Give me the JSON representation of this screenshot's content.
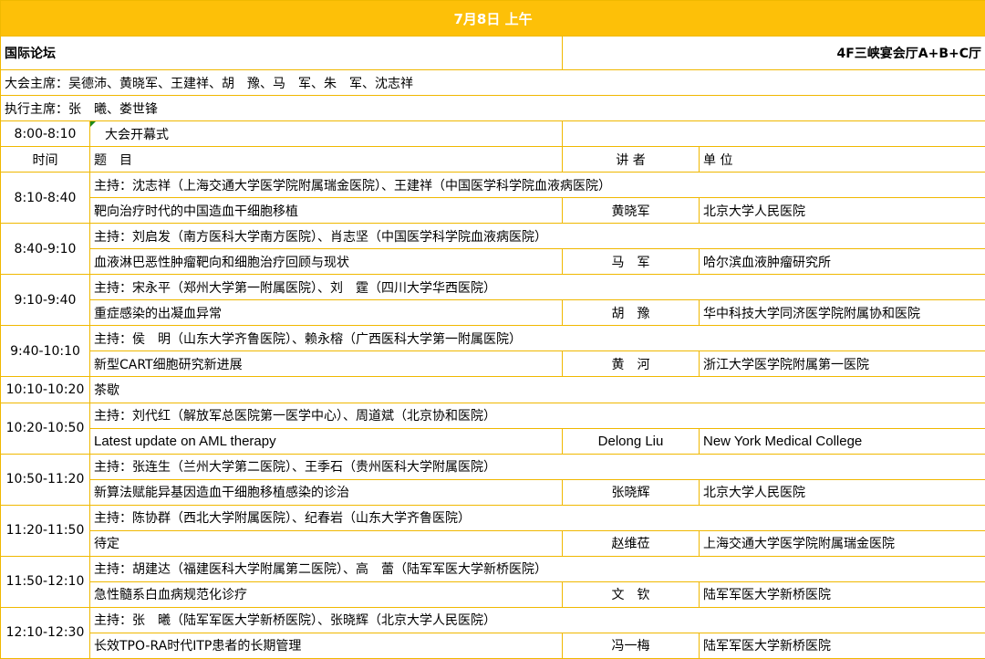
{
  "header": {
    "title": "7月8日  上午"
  },
  "forum": {
    "name": "国际论坛",
    "venue": "4F三峡宴会厅A+B+C厅"
  },
  "chairs": {
    "general": "大会主席：吴德沛、黄晓军、王建祥、胡　豫、马　军、朱　军、沈志祥",
    "executive": "执行主席：张　曦、娄世锋"
  },
  "opening": {
    "time": "8:00-8:10",
    "title": "大会开幕式"
  },
  "columns": {
    "time": "时间",
    "topic": "题　目",
    "speaker": "讲 者",
    "unit": "单 位"
  },
  "sessions": [
    {
      "time": "8:10-8:40",
      "host": "主持：沈志祥（上海交通大学医学院附属瑞金医院）、王建祥（中国医学科学院血液病医院）",
      "topic": "靶向治疗时代的中国造血干细胞移植",
      "speaker": "黄晓军",
      "unit": "北京大学人民医院"
    },
    {
      "time": "8:40-9:10",
      "host": "主持：刘启发（南方医科大学南方医院）、肖志坚（中国医学科学院血液病医院）",
      "topic": "血液淋巴恶性肿瘤靶向和细胞治疗回顾与现状",
      "speaker": "马　军",
      "unit": "哈尔滨血液肿瘤研究所"
    },
    {
      "time": "9:10-9:40",
      "host": "主持：宋永平（郑州大学第一附属医院）、刘　霆（四川大学华西医院）",
      "topic": "重症感染的出凝血异常",
      "speaker": "胡　豫",
      "unit": "华中科技大学同济医学院附属协和医院"
    },
    {
      "time": "9:40-10:10",
      "host": "主持：侯　明（山东大学齐鲁医院）、赖永榕（广西医科大学第一附属医院）",
      "topic": "新型CART细胞研究新进展",
      "speaker": "黄　河",
      "unit": "浙江大学医学院附属第一医院"
    },
    {
      "time": "10:10-10:20",
      "break": "茶歇"
    },
    {
      "time": "10:20-10:50",
      "host": "主持：刘代红（解放军总医院第一医学中心）、周道斌（北京协和医院）",
      "topic": "Latest update on AML therapy",
      "speaker": "Delong Liu",
      "unit": "New York Medical College",
      "english": true
    },
    {
      "time": "10:50-11:20",
      "host": "主持：张连生（兰州大学第二医院）、王季石（贵州医科大学附属医院）",
      "topic": "新算法赋能异基因造血干细胞移植感染的诊治",
      "speaker": "张晓辉",
      "unit": "北京大学人民医院"
    },
    {
      "time": "11:20-11:50",
      "host": "主持：陈协群（西北大学附属医院）、纪春岩（山东大学齐鲁医院）",
      "topic": "待定",
      "speaker": "赵维莅",
      "unit": "上海交通大学医学院附属瑞金医院"
    },
    {
      "time": "11:50-12:10",
      "host": "主持：胡建达（福建医科大学附属第二医院）、高　蕾（陆军军医大学新桥医院）",
      "topic": "急性髓系白血病规范化诊疗",
      "speaker": "文　钦",
      "unit": "陆军军医大学新桥医院"
    },
    {
      "time": "12:10-12:30",
      "host": "主持：张　曦（陆军军医大学新桥医院）、张晓辉（北京大学人民医院）",
      "topic": "长效TPO-RA时代ITP患者的长期管理",
      "speaker": "冯一梅",
      "unit": "陆军军医大学新桥医院"
    }
  ]
}
